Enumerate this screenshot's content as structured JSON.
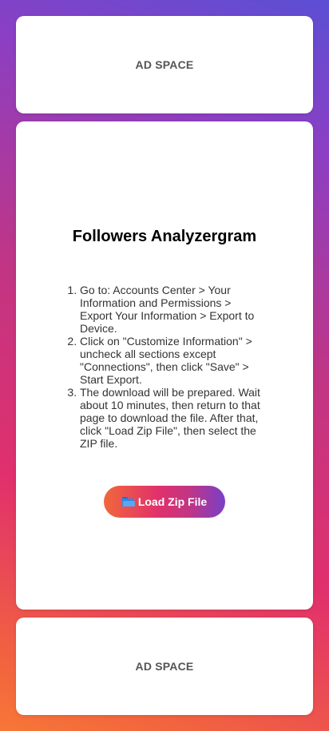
{
  "ads": {
    "top_label": "AD SPACE",
    "bottom_label": "AD SPACE"
  },
  "main": {
    "title": "Followers Analyzergram",
    "steps": [
      "Go to: Accounts Center > Your Information and Permissions > Export Your Information > Export to Device.",
      "Click on \"Customize Information\" > uncheck all sections except \"Connections\", then click \"Save\" > Start Export.",
      "The download will be prepared. Wait about 10 minutes, then return to that page to download the file. After that, click \"Load Zip File\", then select the ZIP file."
    ],
    "load_button": {
      "icon": "folder-icon",
      "label": "Load Zip File"
    }
  },
  "colors": {
    "gradient_top": "#5b4fd4",
    "gradient_mid": "#e1306c",
    "gradient_bottom": "#f77737",
    "card": "#ffffff"
  }
}
